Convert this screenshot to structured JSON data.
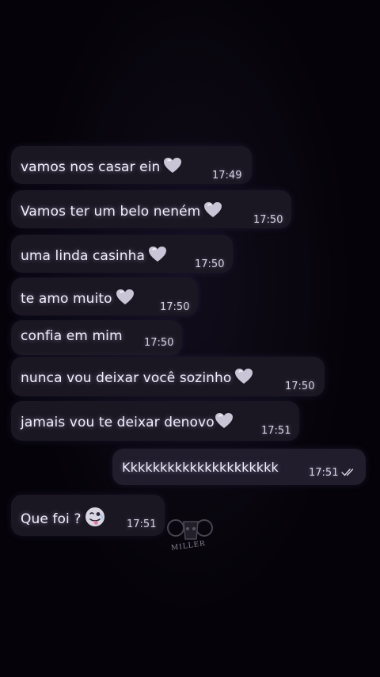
{
  "chat": {
    "messages": [
      {
        "text": "vamos nos casar ein",
        "time": "17:49",
        "heart": true
      },
      {
        "text": "Vamos ter um belo neném",
        "time": "17:50",
        "heart": true
      },
      {
        "text": "uma linda casinha",
        "time": "17:50",
        "heart": true
      },
      {
        "text": "te amo muito",
        "time": "17:50",
        "heart": true
      },
      {
        "text": "confia em mim",
        "time": "17:50",
        "heart": false
      },
      {
        "text": "nunca vou deixar você sozinho",
        "time": "17:50",
        "heart": true
      },
      {
        "text": "jamais vou te deixar denovo",
        "time": "17:51",
        "heart": true
      },
      {
        "text": "Kkkkkkkkkkkkkkkkkkkkk",
        "time": "17:51",
        "outgoing": true,
        "read": true
      },
      {
        "text": "Que foi ?",
        "time": "17:51",
        "emoji": "tongue-face-emoji"
      }
    ]
  },
  "watermark": {
    "text": "MILLER"
  },
  "colors": {
    "background": "#050309",
    "bubble": "#1b1722",
    "heart": "#c9c5d6",
    "text": "#f1eefa"
  }
}
